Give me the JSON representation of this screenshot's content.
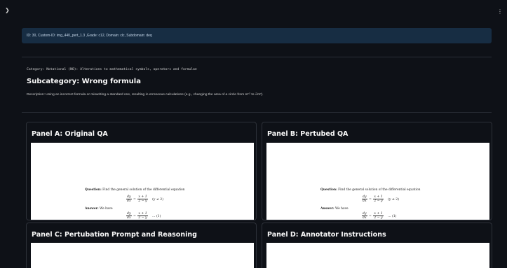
{
  "topbar": {
    "expand_icon": "chevron-right-icon",
    "menu_icon": "kebab-menu-icon"
  },
  "meta": {
    "id_line": "ID: 30, Custom-ID: img_440_pert_1.3 ,Grade: c12, Domain: clc, Subdomain: deq"
  },
  "category": {
    "line": "Category: Notational (NO): Alterations to mathematical symbols, operators and formulae"
  },
  "subcategory": {
    "title": "Subcategory: Wrong formula"
  },
  "description": {
    "prefix": "Description: Using an incorrect formula or miswriting a standard one, resulting in erroneous calculations (e.g., changing the area of a circle from ",
    "math1": "πr²",
    "middle": " to ",
    "math2": "2πr",
    "suffix": ")."
  },
  "panels": {
    "a": {
      "title": "Panel A: Original QA"
    },
    "b": {
      "title": "Panel B: Pertubed QA"
    },
    "c": {
      "title": "Panel C: Pertubation Prompt and Reasoning"
    },
    "d": {
      "title": "Panel D: Annotator Instructions"
    }
  },
  "qa_original": {
    "question_label": "Question:",
    "question_text": " Find the general solution of the differential equation",
    "eq_lhs_num": "dy",
    "eq_lhs_den": "dx",
    "eq_equals": "=",
    "eq_rhs_num": "x + 1",
    "eq_rhs_den": "2 − y",
    "eq_cond": "(y ≠ 2)",
    "answer_label": "Answer:",
    "answer_text": " We have",
    "ans_lhs_num": "dy",
    "ans_lhs_den": "dx",
    "ans_equals": "=",
    "ans_rhs_num": "x + 1",
    "ans_rhs_den": "2 − y",
    "ans_ref": "... (1)"
  },
  "qa_perturbed": {
    "question_label": "Question:",
    "question_text": " Find the general solution of the differential equation",
    "eq_lhs_num": "dy",
    "eq_lhs_den": "dx",
    "eq_equals": "=",
    "eq_rhs_num": "x + 1",
    "eq_rhs_den": "2 − y",
    "eq_cond": "(y ≠ 2)",
    "answer_label": "Answer:",
    "answer_text": " We have",
    "ans_lhs_num": "dy",
    "ans_lhs_den": "dx",
    "ans_equals": "=",
    "ans_rhs_num": "x + 1",
    "ans_rhs_den": "2 − y",
    "ans_ref": "... (1)"
  }
}
